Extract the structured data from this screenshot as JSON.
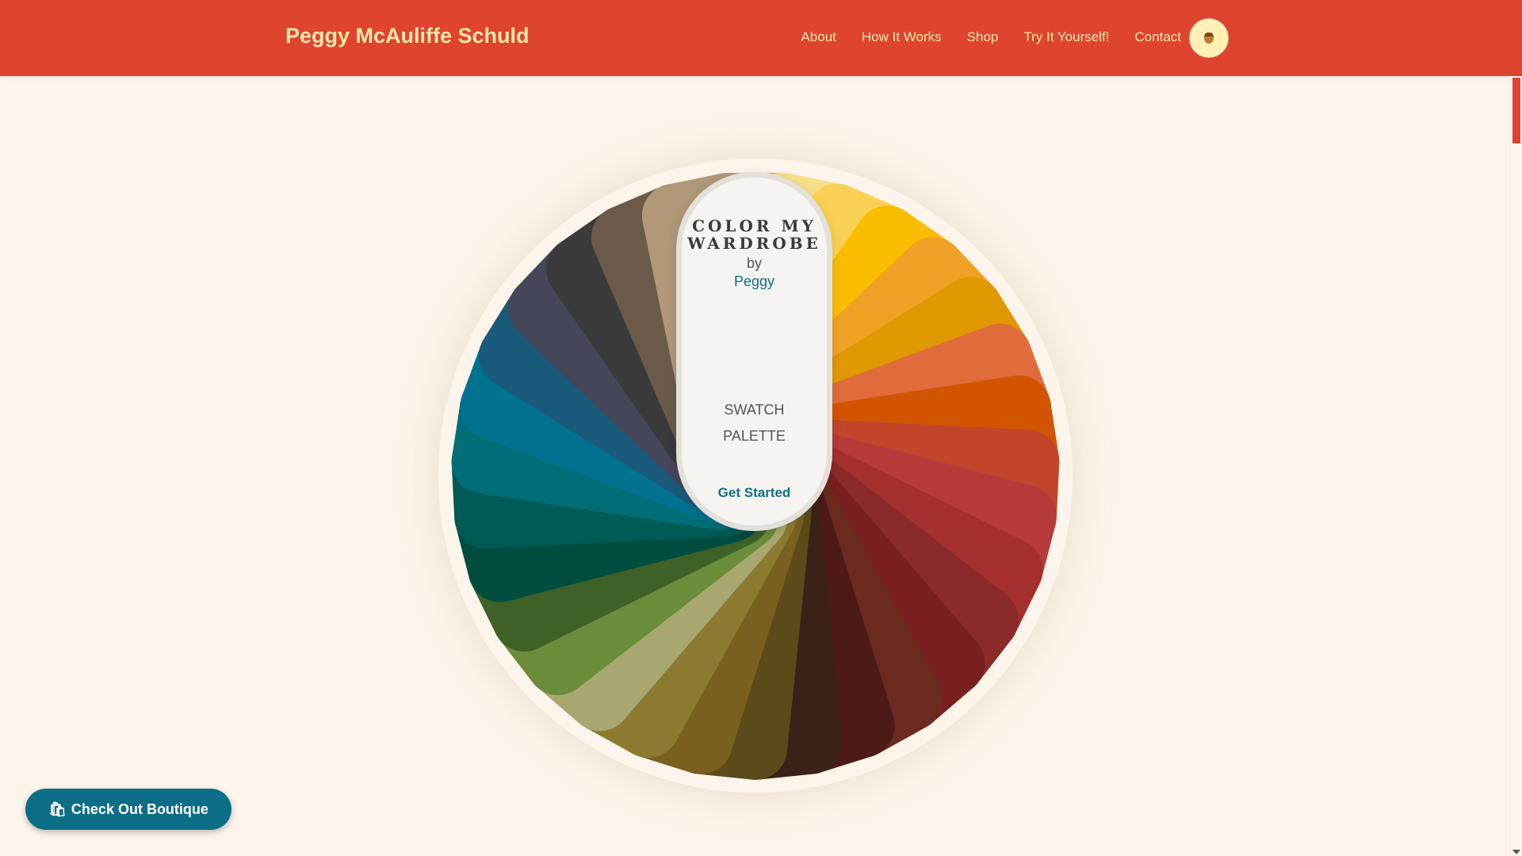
{
  "header": {
    "brand": "Peggy McAuliffe Schuld",
    "nav": [
      "About",
      "How It Works",
      "Shop",
      "Try It Yourself!",
      "Contact"
    ],
    "avatar_icon": "acorn-icon"
  },
  "wheel": {
    "title": "COLOR MY WARDROBE",
    "by": "by",
    "author": "Peggy",
    "subtitle_1": "SWATCH",
    "subtitle_2": "PALETTE",
    "cta": "Get Started",
    "swatches": [
      "#d6bd93",
      "#f6df8a",
      "#fbd155",
      "#fbbd00",
      "#f2a127",
      "#e09900",
      "#e06c3c",
      "#d35400",
      "#c0452a",
      "#b63a3a",
      "#a52f2f",
      "#8b2a2a",
      "#7a1f1f",
      "#6a2a1e",
      "#4e1a18",
      "#3a2218",
      "#5c4a1a",
      "#7a6020",
      "#8c7a30",
      "#a8a870",
      "#6b8c3a",
      "#3d6126",
      "#004d40",
      "#005a55",
      "#006d77",
      "#00718f",
      "#1a5a7a",
      "#44475a",
      "#3a3a3a",
      "#6b5a4a",
      "#b09878"
    ]
  },
  "boutique": {
    "label": "Check Out Boutique",
    "icon": "shopping-bags-icon"
  }
}
